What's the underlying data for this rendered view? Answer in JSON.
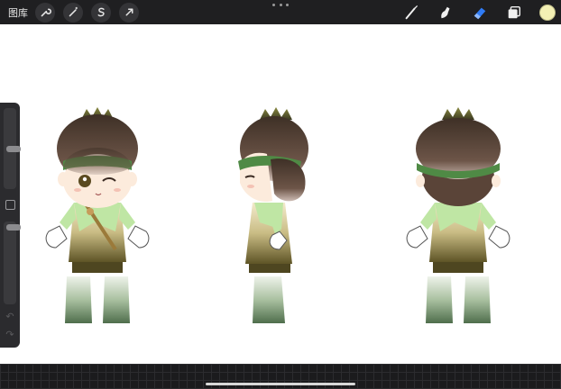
{
  "toolbar": {
    "gallery_label": "图库",
    "left_tools": [
      {
        "name": "actions",
        "icon": "wrench-icon"
      },
      {
        "name": "adjustments",
        "icon": "magic-wand-icon"
      },
      {
        "name": "selection",
        "icon": "selection-s-icon"
      },
      {
        "name": "transform",
        "icon": "arrow-cursor-icon"
      }
    ],
    "right_tools": [
      {
        "name": "brush",
        "icon": "brush-icon"
      },
      {
        "name": "smudge",
        "icon": "smudge-icon"
      },
      {
        "name": "eraser",
        "icon": "eraser-icon",
        "active": true
      },
      {
        "name": "layers",
        "icon": "layers-icon"
      }
    ],
    "current_color": "#f3f0b4",
    "accent_color": "#2f7bf5"
  },
  "sidebar": {
    "brush_size_level": 0.5,
    "opacity_level": 0.97,
    "modify_icon": "square-icon",
    "undo_icon": "undo-icon",
    "redo_icon": "redo-icon"
  },
  "canvas": {
    "views": [
      "front",
      "side",
      "back"
    ],
    "colors": {
      "hair_dark": "#4a3a2e",
      "hair_mid": "#7a6258",
      "headband": "#4f8a45",
      "skin": "#fbe8d8",
      "shirt": "#bfe6a4",
      "tunic_light": "#f0e8c8",
      "tunic_dark": "#6e6230",
      "boots_light": "#dce8d4",
      "boots_dark": "#5e7a5a"
    }
  }
}
